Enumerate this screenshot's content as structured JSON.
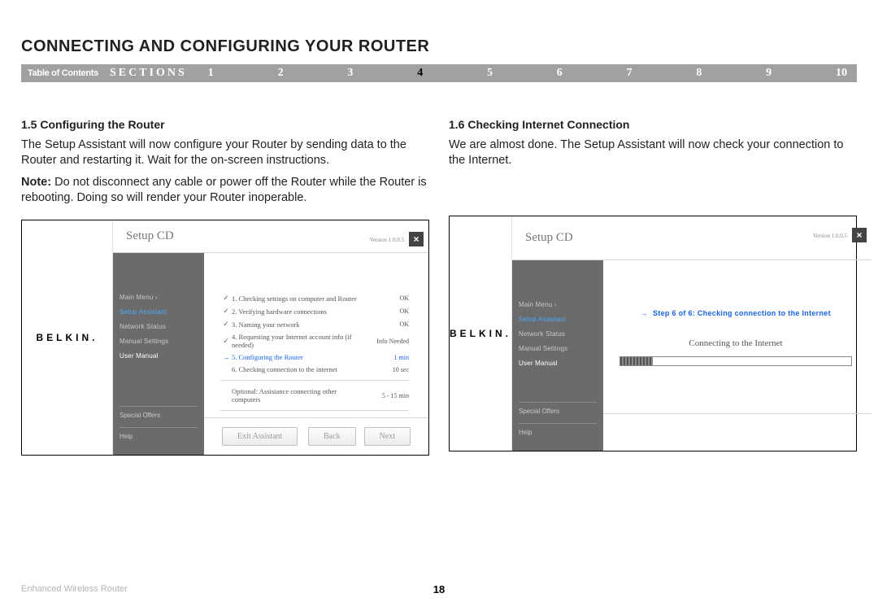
{
  "title": "CONNECTING AND CONFIGURING YOUR ROUTER",
  "nav": {
    "toc": "Table of Contents",
    "sections": "SECTIONS",
    "items": [
      "1",
      "2",
      "3",
      "4",
      "5",
      "6",
      "7",
      "8",
      "9",
      "10"
    ],
    "active_index": 3
  },
  "left": {
    "heading": "1.5 Configuring the Router",
    "p1": "The Setup Assistant will now configure your Router by sending data to the Router and restarting it. Wait for the on-screen instructions.",
    "p2_bold": "Note:",
    "p2_rest": " Do not disconnect any cable or power off the Router while the Router is rebooting. Doing so will render your Router inoperable."
  },
  "right": {
    "heading": "1.6 Checking Internet Connection",
    "p1": "We are almost done. The Setup Assistant will now check your connection to the Internet."
  },
  "wizard_common": {
    "brand": "BELKIN.",
    "header_title": "Setup CD",
    "version": "Version 1.0.0.5",
    "close": "×",
    "menu": {
      "main": "Main Menu  ›",
      "setup": "Setup Assistant",
      "network": "Network Status",
      "manual": "Manual Settings",
      "user": "User Manual",
      "offers": "Special Offers",
      "help": "Help"
    },
    "buttons": {
      "exit": "Exit Assistant",
      "back": "Back",
      "next": "Next"
    }
  },
  "wizard_left": {
    "steps": [
      {
        "icon": "check",
        "label": "1. Checking settings on computer and Router",
        "status": "OK"
      },
      {
        "icon": "check",
        "label": "2. Verifying hardware connections",
        "status": "OK"
      },
      {
        "icon": "check",
        "label": "3. Naming your network",
        "status": "OK"
      },
      {
        "icon": "check",
        "label": "4. Requesting your Internet account info (if needed)",
        "status": "Info Needed"
      },
      {
        "icon": "arrow",
        "label": "5. Configuring the Router",
        "status": "1 min",
        "active": true
      },
      {
        "icon": "",
        "label": "6. Checking connection to the internet",
        "status": "10 sec"
      }
    ],
    "optional": {
      "label": "Optional: Assistance connecting other computers",
      "status": "5 - 15 min"
    }
  },
  "wizard_right": {
    "banner_arrow": "→",
    "banner": "Step 6 of 6: Checking connection to the Internet",
    "connecting": "Connecting to the Internet"
  },
  "footer": {
    "product": "Enhanced Wireless Router",
    "page": "18"
  }
}
